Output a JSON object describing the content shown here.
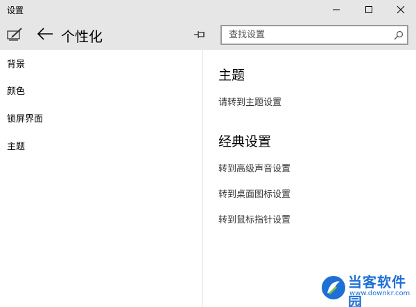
{
  "window": {
    "title": "设置"
  },
  "header": {
    "page_title": "个性化",
    "edit_icon": "edit-icon",
    "back_icon": "back-arrow-icon",
    "pin_icon": "pin-icon"
  },
  "search": {
    "placeholder": "查找设置",
    "value": ""
  },
  "nav": {
    "items": [
      {
        "label": "背景"
      },
      {
        "label": "颜色"
      },
      {
        "label": "锁屏界面"
      },
      {
        "label": "主题"
      }
    ]
  },
  "content": {
    "sections": [
      {
        "title": "主题",
        "links": [
          "请转到主题设置"
        ]
      },
      {
        "title": "经典设置",
        "links": [
          "转到高级声音设置",
          "转到桌面图标设置",
          "转到鼠标指针设置"
        ]
      }
    ]
  },
  "watermark": {
    "name": "当客软件园",
    "url": "www.downkr.com"
  },
  "colors": {
    "titlebar_bg": "#e6e6e6",
    "accent": "#1e6fd6"
  }
}
